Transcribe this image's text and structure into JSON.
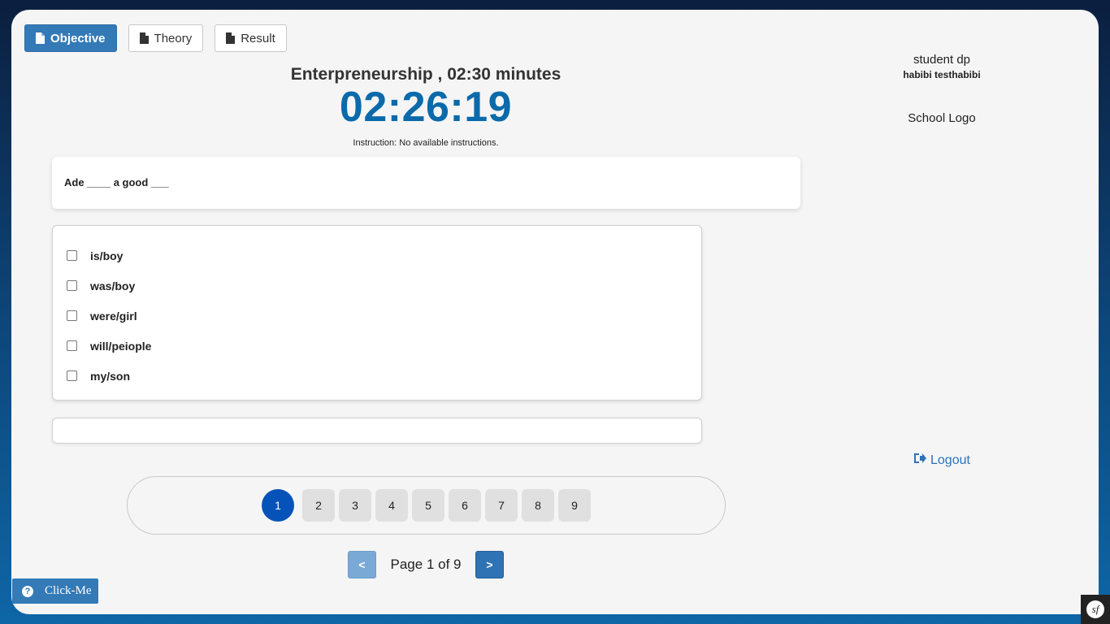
{
  "tabs": [
    {
      "label": "Objective",
      "active": true
    },
    {
      "label": "Theory",
      "active": false
    },
    {
      "label": "Result",
      "active": false
    }
  ],
  "exam": {
    "heading": "Enterpreneurship , 02:30 minutes",
    "timer": "02:26:19",
    "instruction": "Instruction: No available instructions."
  },
  "question": {
    "text": "Ade ____ a good ___"
  },
  "options": [
    {
      "label": "is/boy",
      "checked": false
    },
    {
      "label": "was/boy",
      "checked": false
    },
    {
      "label": "were/girl",
      "checked": false
    },
    {
      "label": "will/peiople",
      "checked": false
    },
    {
      "label": "my/son",
      "checked": false
    }
  ],
  "pagination": {
    "pages": [
      "1",
      "2",
      "3",
      "4",
      "5",
      "6",
      "7",
      "8",
      "9"
    ],
    "current": "1",
    "prev_label": "<",
    "next_label": ">",
    "page_info": "Page 1 of 9"
  },
  "profile": {
    "dp_label": "student dp",
    "name": "habibi testhabibi",
    "school_logo": "School Logo",
    "logout_label": "Logout"
  },
  "help": {
    "label": "Click-Me"
  },
  "badge": {
    "label": "sf"
  },
  "icons": {
    "tab_icon": "file-icon",
    "logout_icon": "sign-out-icon",
    "help_icon": "question-circle-icon"
  },
  "colors": {
    "primary": "#337ab7",
    "timer": "#0a6aaa",
    "current_page": "#0553b8"
  }
}
